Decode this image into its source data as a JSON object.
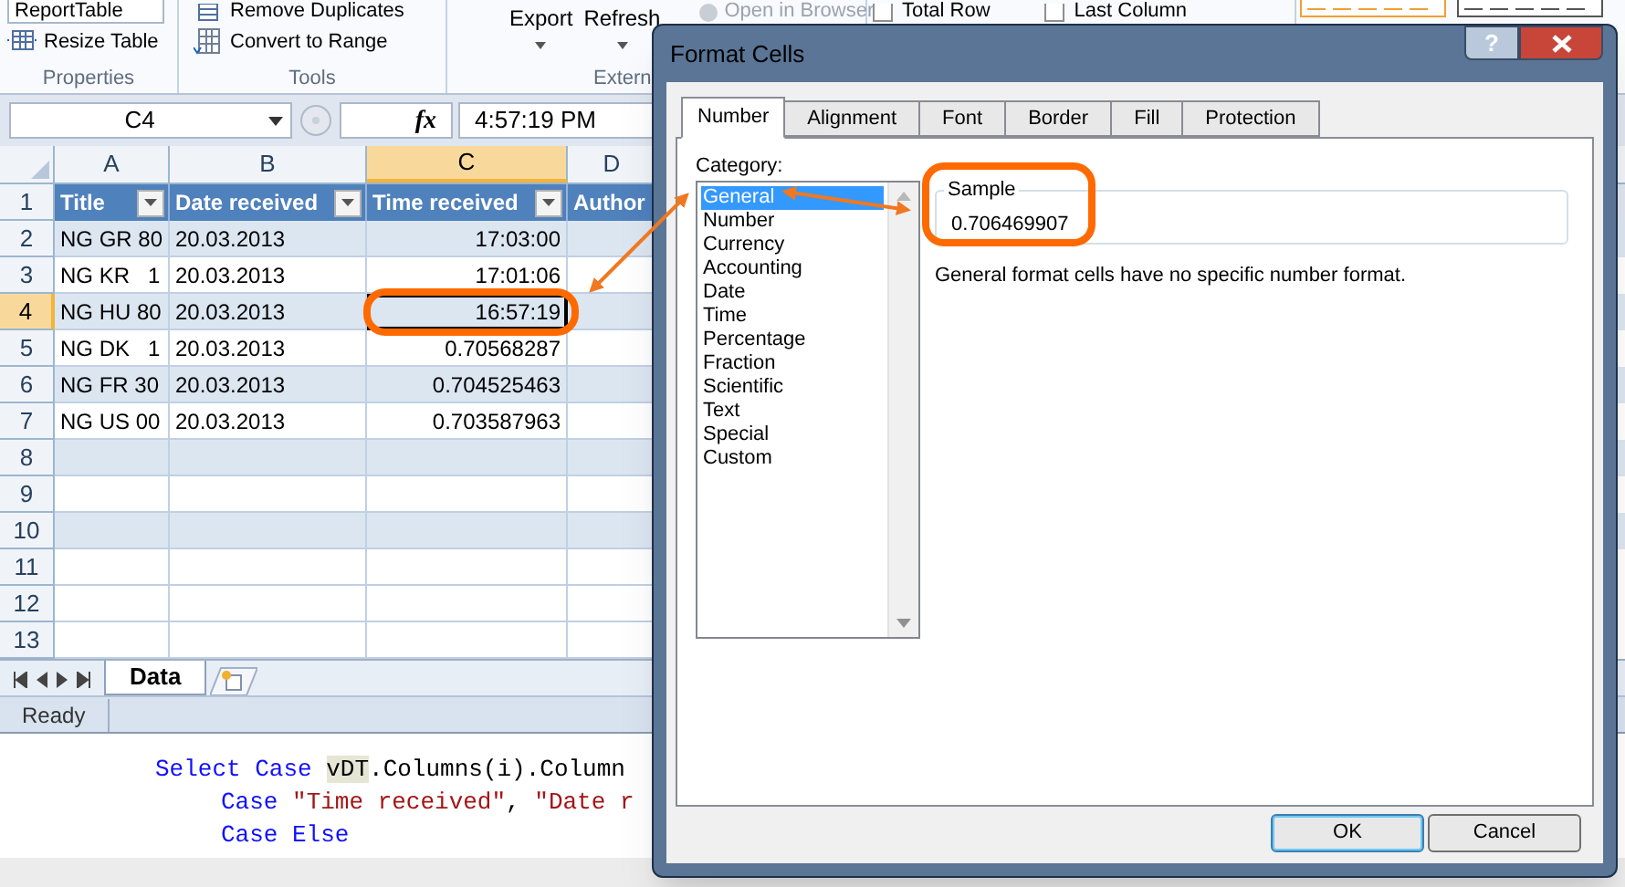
{
  "excel": {
    "ribbon": {
      "properties": {
        "table_name": "ReportTable",
        "resize": "Resize Table",
        "label": "Properties"
      },
      "tools": {
        "commands": [
          "Remove Duplicates",
          "Convert to Range"
        ],
        "label": "Tools"
      },
      "external": {
        "big_buttons": [
          "Export",
          "Refresh"
        ],
        "open_in_browser": {
          "label": "Open in Browser",
          "disabled": true
        },
        "label": "Extern"
      },
      "style_options": [
        {
          "label": "Total Row",
          "checked": false
        },
        {
          "label": "Last Column",
          "checked": false
        }
      ]
    },
    "formula_bar": {
      "name_box": "C4",
      "fx": "fx",
      "value": "4:57:19 PM"
    },
    "columns": [
      {
        "letter": "A",
        "selected": false
      },
      {
        "letter": "B",
        "selected": false
      },
      {
        "letter": "C",
        "selected": true
      },
      {
        "letter": "D",
        "selected": false
      }
    ],
    "header_row": {
      "number": "1",
      "selected": false,
      "cells": [
        "Title",
        "Date received",
        "Time received",
        "Author"
      ]
    },
    "rows": [
      {
        "number": "2",
        "selected": false,
        "banded": true,
        "cells": [
          {
            "text": "NG GR 80",
            "selected": false
          },
          {
            "text": "20.03.2013",
            "selected": false
          },
          {
            "text": "17:03:00",
            "selected": false
          }
        ]
      },
      {
        "number": "3",
        "selected": false,
        "banded": false,
        "cells": [
          {
            "text": "NG KR   1",
            "selected": false
          },
          {
            "text": "20.03.2013",
            "selected": false
          },
          {
            "text": "17:01:06",
            "selected": false
          }
        ]
      },
      {
        "number": "4",
        "selected": true,
        "banded": true,
        "cells": [
          {
            "text": "NG HU 80",
            "selected": false
          },
          {
            "text": "20.03.2013",
            "selected": false
          },
          {
            "text": "16:57:19",
            "selected": true
          }
        ]
      },
      {
        "number": "5",
        "selected": false,
        "banded": false,
        "cells": [
          {
            "text": "NG DK   1",
            "selected": false
          },
          {
            "text": "20.03.2013",
            "selected": false
          },
          {
            "text": "0.70568287",
            "selected": false
          }
        ]
      },
      {
        "number": "6",
        "selected": false,
        "banded": true,
        "cells": [
          {
            "text": "NG FR 30",
            "selected": false
          },
          {
            "text": "20.03.2013",
            "selected": false
          },
          {
            "text": "0.704525463",
            "selected": false
          }
        ]
      },
      {
        "number": "7",
        "selected": false,
        "banded": false,
        "cells": [
          {
            "text": "NG US 00",
            "selected": false
          },
          {
            "text": "20.03.2013",
            "selected": false
          },
          {
            "text": "0.703587963",
            "selected": false
          }
        ]
      },
      {
        "number": "8",
        "selected": false,
        "banded": true
      },
      {
        "number": "9",
        "selected": false,
        "banded": false
      },
      {
        "number": "10",
        "selected": false,
        "banded": true
      },
      {
        "number": "11",
        "selected": false,
        "banded": false
      },
      {
        "number": "12",
        "selected": false,
        "banded": false
      },
      {
        "number": "13",
        "selected": false,
        "banded": false
      }
    ],
    "sheet_tabs": [
      {
        "label": "Data",
        "selected": true
      }
    ],
    "status": "Ready"
  },
  "code": {
    "lines": [
      {
        "kind": "statement",
        "segments": [
          {
            "kind": "keyword",
            "text": "Select Case "
          },
          {
            "kind": "symbol",
            "text": "vDT"
          },
          {
            "kind": "plain",
            "text": ".Columns(i).Column"
          }
        ]
      },
      {
        "kind": "branch",
        "segments": [
          {
            "kind": "keyword",
            "text": "Case "
          },
          {
            "kind": "string",
            "text": "\"Time received\""
          },
          {
            "kind": "plain",
            "text": ", "
          },
          {
            "kind": "string",
            "text": "\"Date r"
          }
        ]
      },
      {
        "kind": "branch",
        "segments": [
          {
            "kind": "keyword",
            "text": "Case Else"
          }
        ]
      }
    ]
  },
  "dialog": {
    "title": "Format Cells",
    "help": "?",
    "tabs": [
      {
        "label": "Number",
        "selected": true
      },
      {
        "label": "Alignment",
        "selected": false
      },
      {
        "label": "Font",
        "selected": false
      },
      {
        "label": "Border",
        "selected": false
      },
      {
        "label": "Fill",
        "selected": false
      },
      {
        "label": "Protection",
        "selected": false
      }
    ],
    "category_label": "Category:",
    "categories": [
      {
        "label": "General",
        "selected": true
      },
      {
        "label": "Number",
        "selected": false
      },
      {
        "label": "Currency",
        "selected": false
      },
      {
        "label": "Accounting",
        "selected": false
      },
      {
        "label": "Date",
        "selected": false
      },
      {
        "label": "Time",
        "selected": false
      },
      {
        "label": "Percentage",
        "selected": false
      },
      {
        "label": "Fraction",
        "selected": false
      },
      {
        "label": "Scientific",
        "selected": false
      },
      {
        "label": "Text",
        "selected": false
      },
      {
        "label": "Special",
        "selected": false
      },
      {
        "label": "Custom",
        "selected": false
      }
    ],
    "sample_label": "Sample",
    "sample_value": "0.706469907",
    "description": "General format cells have no specific number format.",
    "buttons": [
      {
        "label": "OK",
        "default": true
      },
      {
        "label": "Cancel",
        "default": false
      }
    ]
  }
}
